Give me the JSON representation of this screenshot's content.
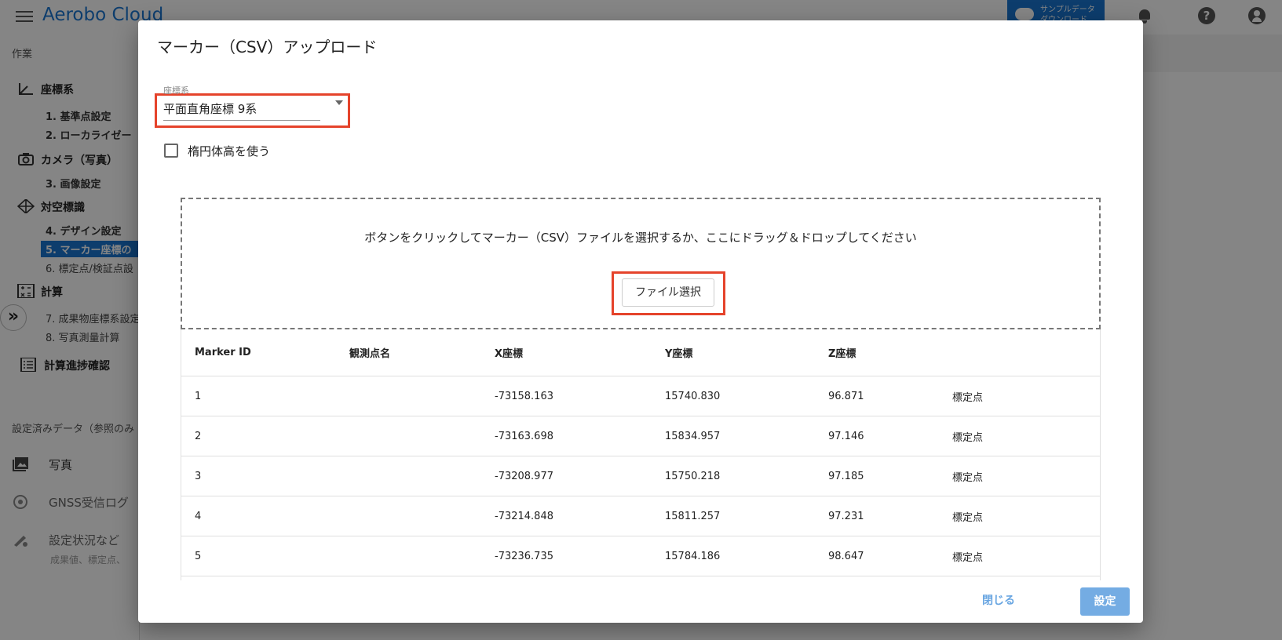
{
  "app": {
    "title": "Aerobo Cloud",
    "sample_button_line1": "サンプルデータ",
    "sample_button_line2": "ダウンロード"
  },
  "sidebar": {
    "section_work": "作業",
    "groups": [
      {
        "icon": "axis-icon",
        "label": "座標系"
      },
      {
        "icon": "camera-icon",
        "label": "カメラ（写真）"
      },
      {
        "icon": "target-icon",
        "label": "対空標識"
      },
      {
        "icon": "calculator-icon",
        "label": "計算"
      },
      {
        "icon": "list-icon",
        "label": "計算進捗確認"
      }
    ],
    "items": [
      {
        "label": "1. 基準点設定"
      },
      {
        "label": "2. ローカライゼー"
      },
      {
        "label": "3. 画像設定"
      },
      {
        "label": "4. デザイン設定"
      },
      {
        "label": "5. マーカー座標の"
      },
      {
        "label": "6. 標定点/検証点設"
      },
      {
        "label": "7. 成果物座標系設定"
      },
      {
        "label": "8. 写真測量計算"
      }
    ],
    "section_data": "設定済みデータ（参照のみ",
    "data_items": [
      {
        "icon": "photo-icon",
        "label": "写真"
      },
      {
        "icon": "gnss-icon",
        "label": "GNSS受信ログ"
      },
      {
        "icon": "settings-status-icon",
        "label": "設定状況など",
        "sub": "成果値、標定点、"
      }
    ],
    "collapse_glyph": "»"
  },
  "dialog": {
    "title": "マーカー（CSV）アップロード",
    "coord_label": "座標系",
    "coord_value": "平面直角座標 9系",
    "ellipsoid_label": "楕円体高を使う",
    "ellipsoid_checked": false,
    "dropzone_text": "ボタンをクリックしてマーカー（CSV）ファイルを選択するか、ここにドラッグ＆ドロップしてください",
    "file_button": "ファイル選択",
    "columns": [
      "Marker ID",
      "観測点名",
      "X座標",
      "Y座標",
      "Z座標",
      ""
    ],
    "rows": [
      [
        "1",
        "",
        "-73158.163",
        "15740.830",
        "96.871",
        "標定点"
      ],
      [
        "2",
        "",
        "-73163.698",
        "15834.957",
        "97.146",
        "標定点"
      ],
      [
        "3",
        "",
        "-73208.977",
        "15750.218",
        "97.185",
        "標定点"
      ],
      [
        "4",
        "",
        "-73214.848",
        "15811.257",
        "97.231",
        "標定点"
      ],
      [
        "5",
        "",
        "-73236.735",
        "15784.186",
        "98.647",
        "標定点"
      ]
    ],
    "close_button": "閉じる",
    "submit_button": "設定",
    "highlight_color": "#e5432b",
    "accent_color": "#1976d2"
  }
}
